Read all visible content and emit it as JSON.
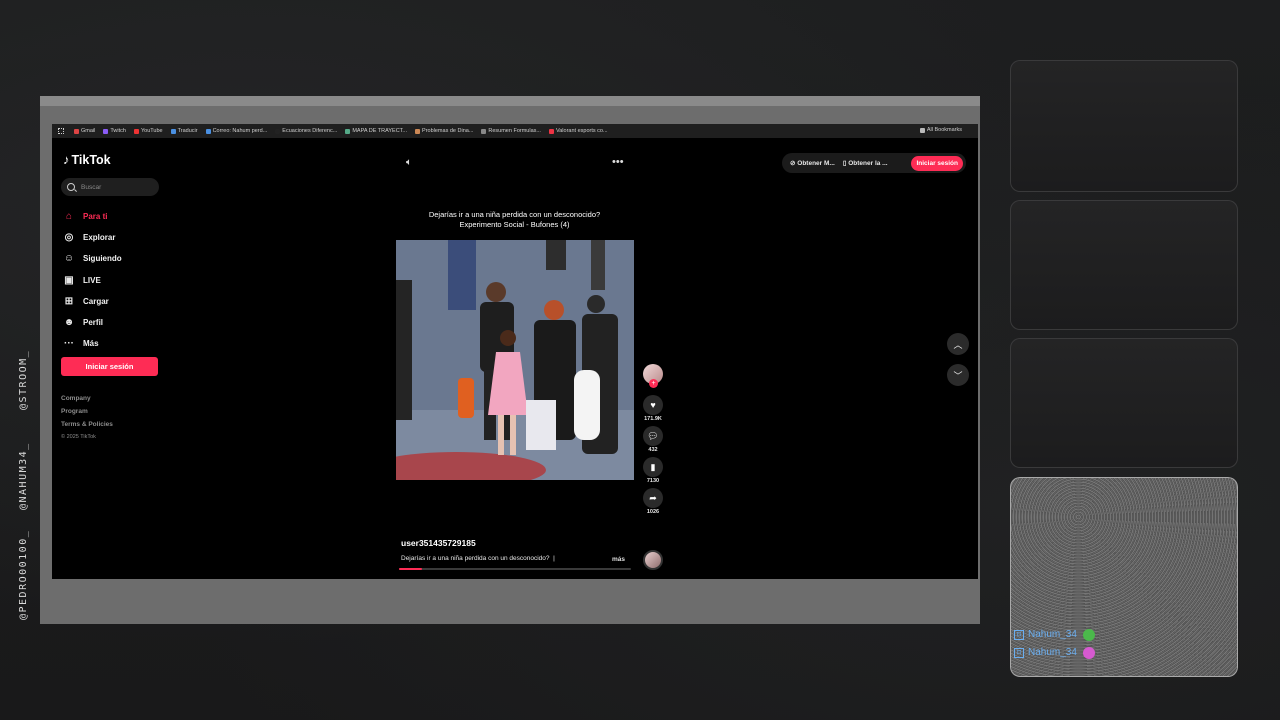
{
  "stream_overlay": {
    "side_credits": [
      "@PEDRO00100_",
      "@NAHUM34_",
      "@STROOM_"
    ],
    "chat": [
      {
        "user": "Nahum_34",
        "emote": "frog-emote",
        "color": "#4bb84b"
      },
      {
        "user": "Nahum_34",
        "emote": "pink-emote",
        "color": "#d65ad0"
      }
    ]
  },
  "browser": {
    "bookmarks": [
      "Gmail",
      "Twitch",
      "YouTube",
      "Traducir",
      "Correo: Nahum perd...",
      "Ecuaciones Diferenc...",
      "MAPA DE TRAYECT...",
      "Problemas de Dina...",
      "Resumen Formulas...",
      "Valorant esports co..."
    ],
    "bookmark_colors": [
      "#d44",
      "#8b5cf6",
      "#e33",
      "#4a90e2",
      "#4a90e2",
      "#222",
      "#5a8",
      "#c85",
      "#888",
      "#e34"
    ],
    "all_bookmarks": "All Bookmarks"
  },
  "tiktok": {
    "logo": "TikTok",
    "search_placeholder": "Buscar",
    "nav": [
      {
        "label": "Para ti",
        "icon": "home-icon",
        "glyph": "⌂",
        "active": true
      },
      {
        "label": "Explorar",
        "icon": "compass-icon",
        "glyph": "◎",
        "active": false
      },
      {
        "label": "Siguiendo",
        "icon": "following-icon",
        "glyph": "☺",
        "active": false
      },
      {
        "label": "LIVE",
        "icon": "live-icon",
        "glyph": "▣",
        "active": false
      },
      {
        "label": "Cargar",
        "icon": "upload-icon",
        "glyph": "⊞",
        "active": false
      },
      {
        "label": "Perfil",
        "icon": "profile-icon",
        "glyph": "☻",
        "active": false
      },
      {
        "label": "Más",
        "icon": "more-icon",
        "glyph": "···",
        "active": false
      }
    ],
    "login_sidebar": "Iniciar sesión",
    "footer": {
      "company": "Company",
      "program": "Program",
      "terms": "Terms & Policies",
      "copyright": "© 2025 TikTok"
    },
    "top_bar": {
      "get_app": "Obtener M...",
      "get_pc": "Obtener la ...",
      "login": "Iniciar sesión"
    },
    "video": {
      "caption_line1": "Dejarías ir a una niña perdida con un desconocido?",
      "caption_line2": "Experimento Social - Bufones (4)",
      "creator": "user351435729185",
      "description": "Dejarías ir a una niña perdida con un desconocido?",
      "more": "más",
      "progress": 0.1
    },
    "actions": {
      "likes": "171.9K",
      "comments": "432",
      "saves": "7130",
      "shares": "1026"
    },
    "accent": "#fe2c55"
  }
}
